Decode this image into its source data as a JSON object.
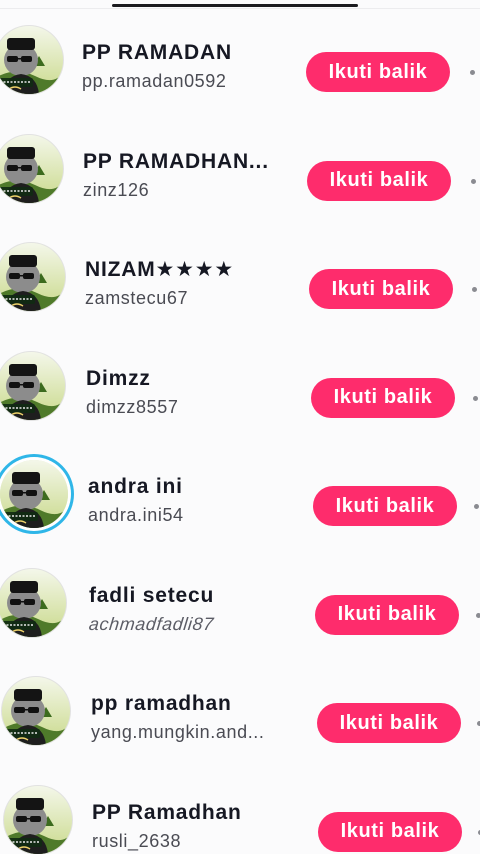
{
  "app": {
    "follow_back_label": "Ikuti balik"
  },
  "followers": [
    {
      "name": "PP RAMADAN",
      "handle": "pp.ramadan0592",
      "avatar": "ramadan-character-avatar",
      "has_story": false
    },
    {
      "name": "PP RAMADHAN...",
      "handle": "zinz126",
      "avatar": "ramadan-character-avatar",
      "has_story": false
    },
    {
      "name": "NIZAM★★★★",
      "handle": "zamstecu67",
      "avatar": "ramadan-character-avatar",
      "has_story": false
    },
    {
      "name": "Dimzz",
      "handle": "dimzz8557",
      "avatar": "ramadan-character-avatar",
      "has_story": false
    },
    {
      "name": "andra ini",
      "handle": "andra.ini54",
      "avatar": "ramadan-character-avatar",
      "has_story": true
    },
    {
      "name": "fadli setecu",
      "handle": "achmadfadli87",
      "avatar": "ramadan-character-avatar",
      "has_story": false
    },
    {
      "name": "pp ramadhan",
      "handle": "yang.mungkin.and...",
      "avatar": "ramadan-character-avatar",
      "has_story": false
    },
    {
      "name": "PP Ramadhan",
      "handle": "rusli_2638",
      "avatar": "ramadan-character-avatar",
      "has_story": false
    }
  ],
  "colors": {
    "follow_button": "#fe2c6c",
    "story_ring": "#2fb6e8",
    "name_text": "#161823",
    "handle_text": "#4a4b53"
  }
}
